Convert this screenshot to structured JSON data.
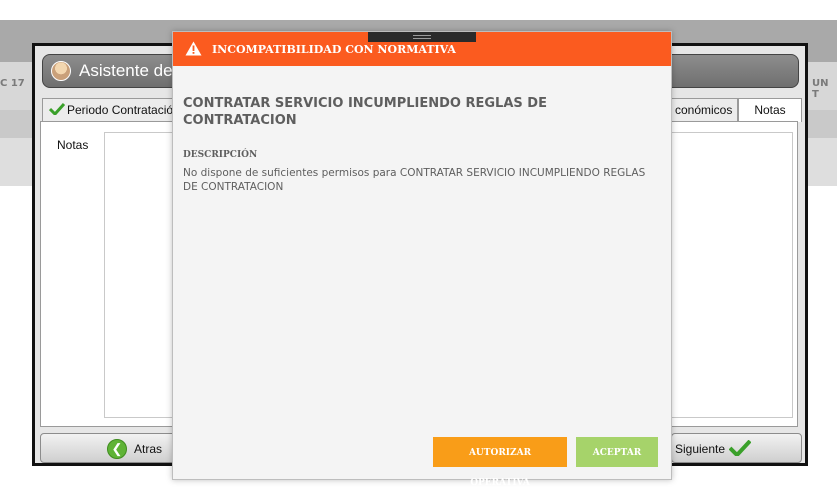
{
  "background": {
    "left_label": "C 17",
    "right_label": "UN T"
  },
  "wizard": {
    "title": "Asistente de",
    "tabs": [
      {
        "label": "Periodo Contratación",
        "completed": true
      },
      {
        "label": "conómicos",
        "completed": false
      },
      {
        "label": "Notas",
        "completed": false,
        "selected": true
      }
    ],
    "notas_label": "Notas",
    "notas_value": "",
    "back_button": "Atras",
    "next_button": "Siguiente"
  },
  "dialog": {
    "title": "INCOMPATIBILIDAD CON NORMATIVA",
    "message": "CONTRATAR SERVICIO INCUMPLIENDO REGLAS DE CONTRATACION",
    "description_label": "DESCRIPCIÓN",
    "description": "No dispone de suficientes permisos para CONTRATAR SERVICIO INCUMPLIENDO REGLAS DE CONTRATACION",
    "authorize_button": "AUTORIZAR OPERATIVA",
    "accept_button": "ACEPTAR"
  },
  "colors": {
    "header_accent": "#fb5b1f",
    "authorize": "#f99d18",
    "accept": "#a6d36a",
    "check_green": "#3aa02a"
  },
  "icons": [
    "warning-icon",
    "checkmark-icon",
    "arrow-left-icon",
    "user-avatar-icon"
  ]
}
